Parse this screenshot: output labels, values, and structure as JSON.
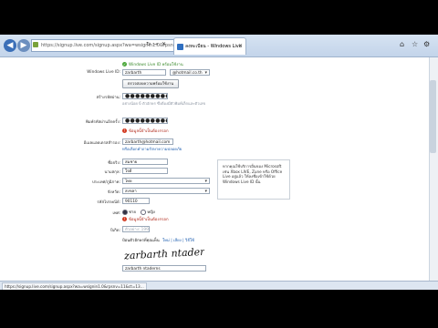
{
  "browser": {
    "address": "https://signup.live.com/signup.aspx?wa=wsignin1.0&rpsnv=11&ct=13…",
    "address_refresh": "↻",
    "address_go": "→",
    "address_close": "✕",
    "tab_title": "ลงทะเบียน - Windows Live",
    "tab_close": "✕",
    "home_icon": "⌂",
    "star_icon": "☆",
    "gear_icon": "⚙",
    "status_url": "https://signup.live.com/signup.aspx?wa=wsignin1.0&rpsnv=11&ct=13…"
  },
  "form": {
    "available_note": "Windows Live ID พร้อมใช้งาน",
    "windows_live_id_label": "Windows Live ID:",
    "windows_live_id_value": "zarbarth",
    "domain_value": "@hotmail.co.th",
    "check_button": "ตรวจสอบความพร้อมใช้งาน",
    "password_label": "สร้างรหัสผ่าน:",
    "password_value": "●●●●●●●●●●●●",
    "password_hint": "อย่างน้อย 6 ตัวอักษร ซึ่งต้องมีตัวพิมพ์เล็กและตัวเลข",
    "retype_label": "พิมพ์รหัสผ่านอีกครั้ง:",
    "retype_value": "●●●●●●●●●●●●",
    "retype_error": "ข้อมูลนี้จำเป็นต้องกรอก",
    "alt_email_label": "อีเมลแอดเดรสสำรอง:",
    "alt_email_value": "zarbarth@hotmail.com",
    "alt_email_link": "หรือเลือกคำถามรักษาความปลอดภัย",
    "first_name_label": "ชื่อจริง:",
    "first_name_value": "สมชาย",
    "last_name_label": "นามสกุล:",
    "last_name_value": "ใจดี",
    "country_label": "ประเทศ/ภูมิภาค:",
    "country_value": "ไทย",
    "province_label": "จังหวัด:",
    "province_value": "สงขลา",
    "zip_label": "รหัสไปรษณีย์:",
    "zip_value": "90110",
    "gender_label": "เพศ:",
    "gender_male": "ชาย",
    "gender_female": "หญิง",
    "gender_error": "ข้อมูลนี้จำเป็นต้องกรอก",
    "birth_label": "ปีเกิด:",
    "birth_placeholder": "ตัวอย่าง: 1990",
    "captcha_hint": "ป้อนตัวอักษรที่คุณเห็น",
    "captcha_links": "ใหม่ | เสียง | วิธีใช้",
    "captcha_text_value": "zarbarth ntaderns",
    "captcha_field_value": "zarbarth ntaderns"
  },
  "info_box": {
    "text": "หากคุณใช้บริการอื่นของ Microsoft เช่น Xbox LIVE, Zune หรือ Office Live อยู่แล้ว ให้ลงชื่อเข้าใช้ด้วย Windows Live ID นั้น"
  }
}
